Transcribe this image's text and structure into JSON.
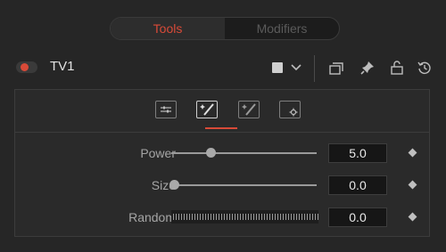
{
  "colors": {
    "accent": "#d84a38",
    "background": "#262626",
    "panel": "#2a2a2a",
    "field": "#161616"
  },
  "tabs": [
    {
      "label": "Tools",
      "active": true
    },
    {
      "label": "Modifiers",
      "active": false
    }
  ],
  "node": {
    "name": "TV1",
    "enabled": true,
    "color_swatch": "#cfcfcf",
    "header_icons": [
      "color-swatch-icon",
      "chevron-down-icon",
      "view-window-icon",
      "pin-icon",
      "lock-icon",
      "reset-icon"
    ]
  },
  "subtabs": [
    {
      "icon": "controls-icon",
      "active": false
    },
    {
      "icon": "magic-wand-icon",
      "active": true
    },
    {
      "icon": "magic-wand-alt-icon",
      "active": false
    },
    {
      "icon": "settings-icon",
      "active": false
    }
  ],
  "params": {
    "power": {
      "label": "Power",
      "value": "5.0",
      "slider_fraction": 0.27
    },
    "size": {
      "label": "Size",
      "value": "0.0",
      "slider_fraction": 0.02
    },
    "random": {
      "label": "Random",
      "value": "0.0"
    }
  }
}
